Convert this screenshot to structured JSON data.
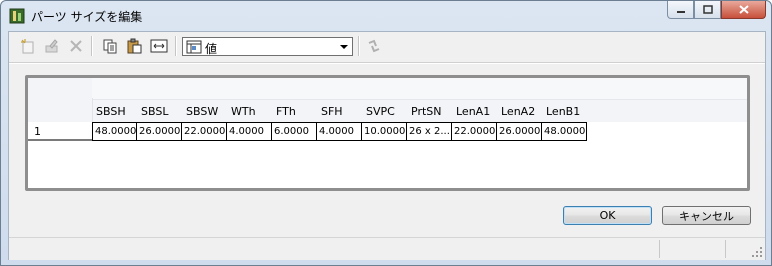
{
  "window": {
    "title": "パーツ サイズを編集"
  },
  "toolbar": {
    "buttons": [
      "new-icon",
      "edit-icon",
      "delete-icon",
      "copy-icon",
      "paste-icon",
      "fit-width-icon",
      "refresh-icon"
    ],
    "combo_value": "値"
  },
  "grid": {
    "columns": [
      "SBSH",
      "SBSL",
      "SBSW",
      "WTh",
      "FTh",
      "SFH",
      "SVPC",
      "PrtSN",
      "LenA1",
      "LenA2",
      "LenB1"
    ],
    "rows": [
      {
        "num": "1",
        "cells": [
          "48.0000",
          "26.0000",
          "22.0000",
          "4.0000",
          "6.0000",
          "4.0000",
          "10.0000",
          "26 x 2...",
          "22.0000",
          "26.0000",
          "48.0000"
        ]
      }
    ]
  },
  "buttons": {
    "ok": "OK",
    "cancel": "キャンセル"
  },
  "colors": {
    "title_bar": "#dce6f2",
    "close_button": "#c7503a",
    "ok_focus": "#3c7fb1"
  }
}
